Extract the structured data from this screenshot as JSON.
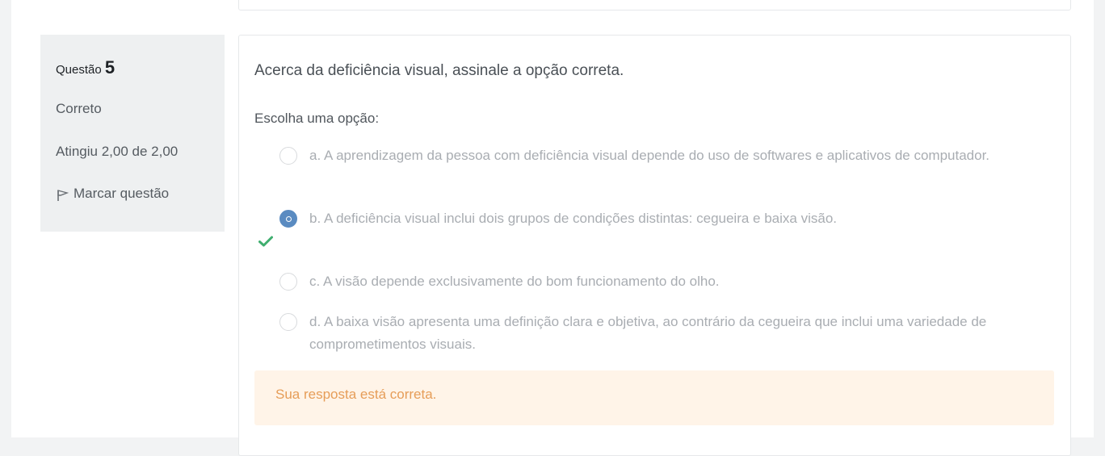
{
  "question": {
    "label": "Questão",
    "number": "5",
    "status": "Correto",
    "grade": "Atingiu 2,00 de 2,00",
    "flag_label": "Marcar questão",
    "text": "Acerca da deficiência visual, assinale a opção correta.",
    "prompt": "Escolha uma opção:",
    "options": [
      {
        "text": "a. A aprendizagem da pessoa com deficiência visual depende do uso de softwares e aplicativos de computador.",
        "selected": false
      },
      {
        "text": "b. A deficiência visual inclui dois grupos de condições distintas: cegueira e baixa visão.",
        "selected": true
      },
      {
        "text": "c. A visão depende exclusivamente do bom funcionamento do olho.",
        "selected": false
      },
      {
        "text": "d. A baixa visão apresenta uma definição clara e objetiva, ao contrário da cegueira que inclui uma variedade de comprometimentos visuais.",
        "selected": false
      }
    ],
    "feedback": "Sua resposta está correta."
  },
  "colors": {
    "accent": "#5a8bc1",
    "correct_check": "#3fae6f",
    "feedback_bg": "#fff4e8",
    "feedback_text": "#e69d58"
  }
}
